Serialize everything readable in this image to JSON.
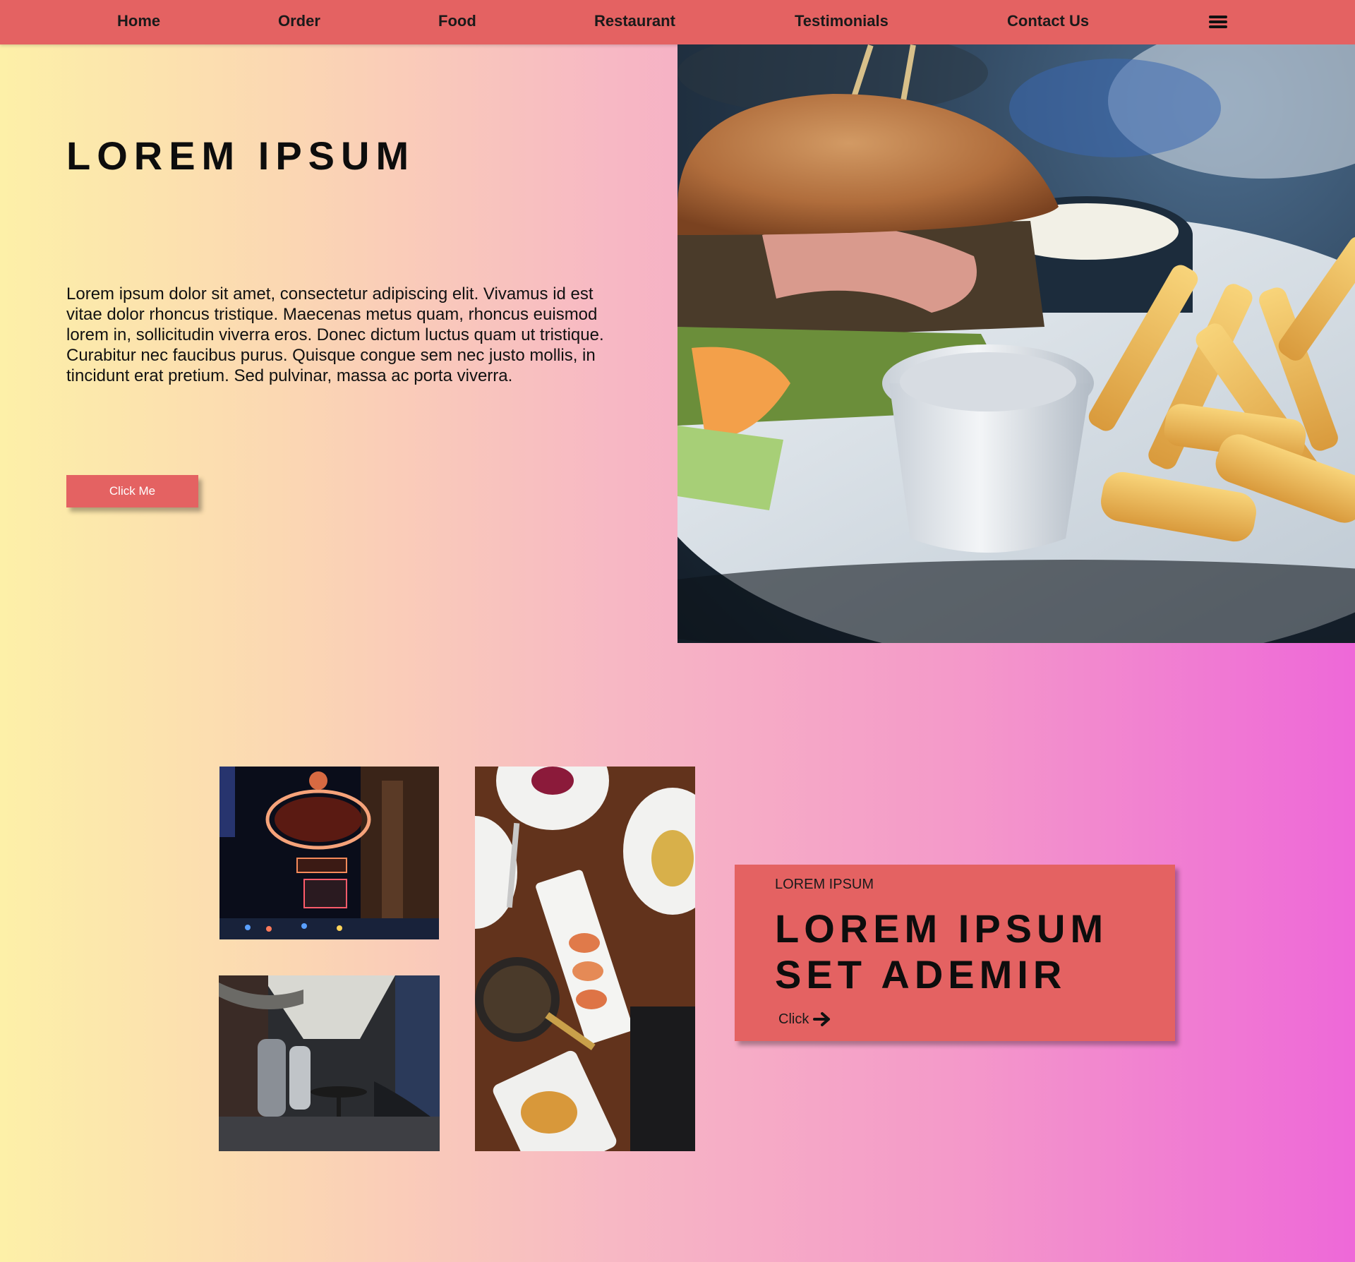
{
  "nav": {
    "items": [
      {
        "label": "Home"
      },
      {
        "label": "Order"
      },
      {
        "label": "Food"
      },
      {
        "label": "Restaurant"
      },
      {
        "label": "Testimonials"
      },
      {
        "label": "Contact Us"
      }
    ],
    "menu_icon": "hamburger-menu-icon",
    "background_color": "#e46262"
  },
  "hero": {
    "title": "LOREM IPSUM",
    "text": "Lorem ipsum dolor sit amet, consectetur adipiscing elit. Vivamus id est vitae dolor rhoncus tristique. Maecenas metus quam, rhoncus euismod lorem in, sollicitudin viverra eros. Donec dictum luctus quam ut tristique. Curabitur nec faucibus purus. Quisque congue sem nec justo mollis, in tincidunt erat pretium. Sed pulvinar, massa ac porta viverra.",
    "button_label": "Click Me",
    "accent_color": "#e46262"
  },
  "card": {
    "eyebrow": "LOREM IPSUM",
    "title": "LOREM IPSUM SET ADEMIR",
    "link_label": "Click",
    "link_icon": "arrow-right-icon"
  }
}
